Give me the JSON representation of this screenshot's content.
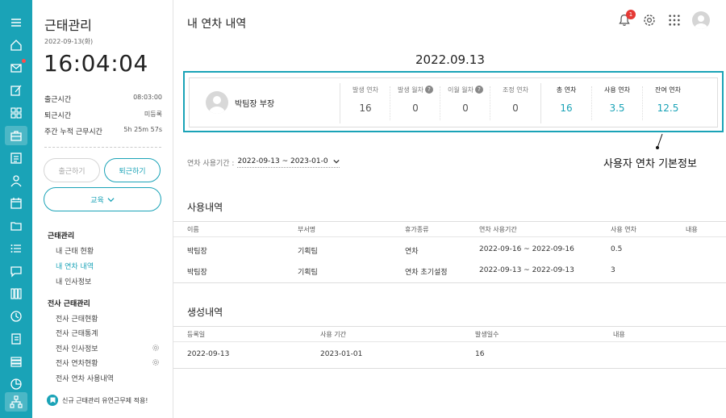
{
  "rail": {
    "icons": [
      "menu-icon",
      "home-icon",
      "mail-icon",
      "edit-icon",
      "apps-grid-icon",
      "briefcase-icon",
      "contacts-card-icon",
      "user-icon",
      "calendar-icon",
      "folder-icon",
      "list-icon",
      "chat-icon",
      "columns-icon",
      "clock-icon",
      "book-icon",
      "stack-icon",
      "pie-icon",
      "org-chart-icon"
    ]
  },
  "side": {
    "title": "근태관리",
    "date": "2022-09-13(화)",
    "time": "16:04:04",
    "rows": [
      {
        "key": "출근시간",
        "value": "08:03:00"
      },
      {
        "key": "퇴근시간",
        "value": "미등록"
      },
      {
        "key": "주간 누적 근무시간",
        "value": "5h 25m 57s"
      }
    ],
    "btn_in": "출근하기",
    "btn_out": "퇴근하기",
    "btn_edu": "교육",
    "group1_title": "근태관리",
    "group1_items": [
      "내 근태 현황",
      "내 연차 내역",
      "내 인사정보"
    ],
    "group2_title": "전사 근태관리",
    "group2_items": [
      "전사 근태현황",
      "전사 근태통계",
      "전사 인사정보",
      "전사 연차현황",
      "전사 연차 사용내역"
    ],
    "notice": "신규 근태관리 유연근무제 적용!"
  },
  "header": {
    "title": "내 연차 내역",
    "notif_count": "1"
  },
  "summary": {
    "date": "2022.09.13",
    "user": "박팀장 부장",
    "cells": [
      {
        "label": "발생 연차",
        "value": "16",
        "help": false
      },
      {
        "label": "발생 월차",
        "value": "0",
        "help": true
      },
      {
        "label": "이월 월차",
        "value": "0",
        "help": true
      },
      {
        "label": "조정 연차",
        "value": "0",
        "help": false
      },
      {
        "label": "총 연차",
        "value": "16",
        "help": false
      },
      {
        "label": "사용 연차",
        "value": "3.5",
        "help": false
      },
      {
        "label": "잔여 연차",
        "value": "12.5",
        "help": false
      }
    ],
    "callout": "사용자 연차 기본정보"
  },
  "period": {
    "label": "연차 사용기간 :",
    "value": "2022-09-13 ~ 2023-01-0"
  },
  "usage": {
    "title": "사용내역",
    "headers": [
      "이름",
      "부서명",
      "휴가종류",
      "연차 사용기간",
      "사용 연차",
      "내용"
    ],
    "rows": [
      [
        "박팀장",
        "기획팀",
        "연차",
        "2022-09-16 ~ 2022-09-16",
        "0.5",
        ""
      ],
      [
        "박팀장",
        "기획팀",
        "연차 초기설정",
        "2022-09-13 ~ 2022-09-13",
        "3",
        ""
      ]
    ]
  },
  "creation": {
    "title": "생성내역",
    "headers": [
      "등록일",
      "사용 기간",
      "발생일수",
      "내용"
    ],
    "rows": [
      [
        "2022-09-13",
        "2023-01-01",
        "16",
        ""
      ]
    ]
  }
}
